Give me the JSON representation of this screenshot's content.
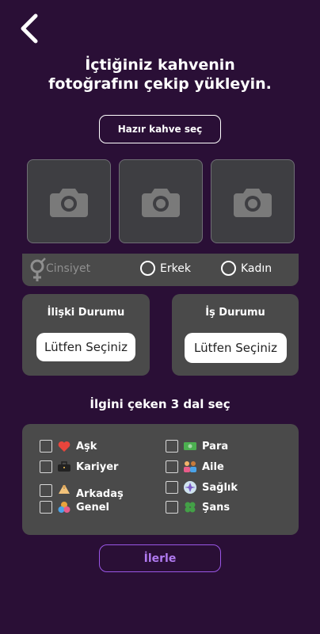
{
  "header": {
    "back_icon": "chevron-left-icon"
  },
  "headline": {
    "line1": "İçtiğiniz kahvenin",
    "line2": "fotoğrafını çekip yükleyin."
  },
  "ready_coffee_button": "Hazır kahve seç",
  "photo_slots": [
    {
      "icon": "camera-icon"
    },
    {
      "icon": "camera-icon"
    },
    {
      "icon": "camera-icon"
    }
  ],
  "gender": {
    "icon": "gender-icon",
    "label": "Cinsiyet",
    "options": [
      "Erkek",
      "Kadın"
    ]
  },
  "relationship": {
    "title": "İlişki Durumu",
    "select_value": "Lütfen Seçiniz"
  },
  "job": {
    "title": "İş Durumu",
    "select_value": "Lütfen Seçiniz"
  },
  "interests": {
    "title": "İlgini çeken 3 dal seç",
    "items": [
      {
        "label": "Aşk",
        "icon": "heart-icon"
      },
      {
        "label": "Para",
        "icon": "money-icon"
      },
      {
        "label": "Kariyer",
        "icon": "briefcase-icon"
      },
      {
        "label": "Aile",
        "icon": "family-icon"
      },
      {
        "label": "Arkadaş",
        "icon": "handshake-icon"
      },
      {
        "label": "Sağlık",
        "icon": "health-icon"
      },
      {
        "label": "Genel",
        "icon": "general-icon"
      },
      {
        "label": "Şans",
        "icon": "clover-icon"
      }
    ]
  },
  "next_button": "İlerle",
  "colors": {
    "background": "#2a0f36",
    "card": "#4a4a4a",
    "accent": "#9a56e6"
  }
}
